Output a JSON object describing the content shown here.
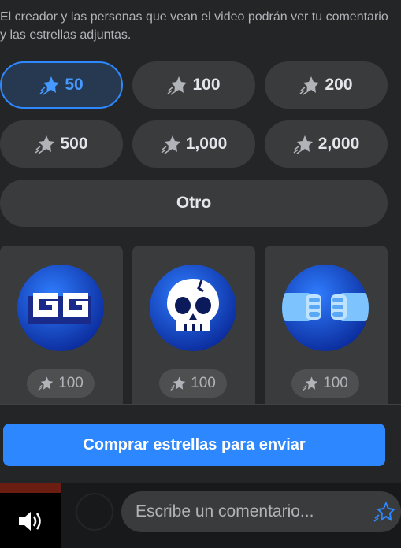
{
  "description": "El creador y las personas que vean el video podrán ver tu comentario y las estrellas adjuntas.",
  "amounts": [
    {
      "label": "50",
      "selected": true,
      "icon": "star-icon"
    },
    {
      "label": "100",
      "selected": false,
      "icon": "star-icon"
    },
    {
      "label": "200",
      "selected": false,
      "icon": "star-icon"
    },
    {
      "label": "500",
      "selected": false,
      "icon": "star-icon"
    },
    {
      "label": "1,000",
      "selected": false,
      "icon": "star-icon"
    },
    {
      "label": "2,000",
      "selected": false,
      "icon": "star-icon"
    }
  ],
  "other_label": "Otro",
  "stickers": [
    {
      "icon": "gg-sticker-icon",
      "price": "100"
    },
    {
      "icon": "skull-sticker-icon",
      "price": "100"
    },
    {
      "icon": "fist-bump-sticker-icon",
      "price": "100"
    }
  ],
  "buy_button_label": "Comprar estrellas para enviar",
  "comment": {
    "placeholder": "Escribe un comentario...",
    "value": ""
  },
  "colors": {
    "accent": "#2d88ff",
    "panel_bg": "#242526",
    "button_bg": "#3a3b3c"
  }
}
